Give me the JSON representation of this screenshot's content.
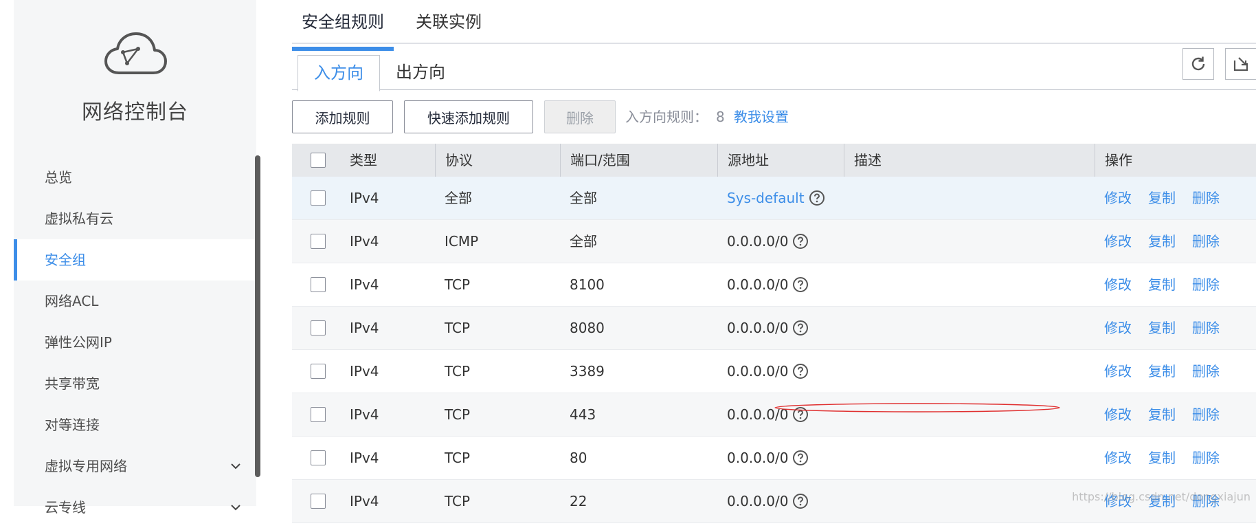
{
  "sidebar": {
    "title": "网络控制台",
    "items": [
      {
        "label": "总览",
        "active": false
      },
      {
        "label": "虚拟私有云",
        "active": false
      },
      {
        "label": "安全组",
        "active": true
      },
      {
        "label": "网络ACL",
        "active": false
      },
      {
        "label": "弹性公网IP",
        "active": false
      },
      {
        "label": "共享带宽",
        "active": false
      },
      {
        "label": "对等连接",
        "active": false
      },
      {
        "label": "虚拟专用网络",
        "active": false,
        "expandable": true
      },
      {
        "label": "云专线",
        "active": false,
        "expandable": true
      }
    ]
  },
  "tabs": [
    {
      "label": "安全组规则",
      "active": true
    },
    {
      "label": "关联实例",
      "active": false
    }
  ],
  "direction_tabs": [
    {
      "label": "入方向",
      "active": true
    },
    {
      "label": "出方向",
      "active": false
    }
  ],
  "toolbar": {
    "add_rule": "添加规则",
    "quick_add_rule": "快速添加规则",
    "delete": "删除",
    "rule_count_label": "入方向规则：",
    "rule_count": "8",
    "help_link": "教我设置"
  },
  "table": {
    "columns": [
      "类型",
      "协议",
      "端口/范围",
      "源地址",
      "描述",
      "操作"
    ],
    "rows": [
      {
        "type": "IPv4",
        "protocol": "全部",
        "port": "全部",
        "source": "Sys-default",
        "source_link": true,
        "description": ""
      },
      {
        "type": "IPv4",
        "protocol": "ICMP",
        "port": "全部",
        "source": "0.0.0.0/0",
        "source_link": false,
        "description": ""
      },
      {
        "type": "IPv4",
        "protocol": "TCP",
        "port": "8100",
        "source": "0.0.0.0/0",
        "source_link": false,
        "description": ""
      },
      {
        "type": "IPv4",
        "protocol": "TCP",
        "port": "8080",
        "source": "0.0.0.0/0",
        "source_link": false,
        "description": ""
      },
      {
        "type": "IPv4",
        "protocol": "TCP",
        "port": "3389",
        "source": "0.0.0.0/0",
        "source_link": false,
        "description": ""
      },
      {
        "type": "IPv4",
        "protocol": "TCP",
        "port": "443",
        "source": "0.0.0.0/0",
        "source_link": false,
        "description": ""
      },
      {
        "type": "IPv4",
        "protocol": "TCP",
        "port": "80",
        "source": "0.0.0.0/0",
        "source_link": false,
        "description": ""
      },
      {
        "type": "IPv4",
        "protocol": "TCP",
        "port": "22",
        "source": "0.0.0.0/0",
        "source_link": false,
        "description": ""
      }
    ],
    "actions": {
      "modify": "修改",
      "copy": "复制",
      "delete": "删除"
    }
  },
  "icons": {
    "brand": "cloud-icon",
    "refresh": "refresh-icon",
    "export": "export-icon",
    "help": "question-circle-icon",
    "expand": "chevron-down-icon"
  },
  "colors": {
    "accent": "#3d8ee8",
    "sidebar_bg": "#f5f6f7",
    "header_bg": "#e6e8eb",
    "highlight_row": "#edf4fa",
    "annotation": "#e03030"
  },
  "watermark": "https://blog.csdn.net/dongxiajun"
}
